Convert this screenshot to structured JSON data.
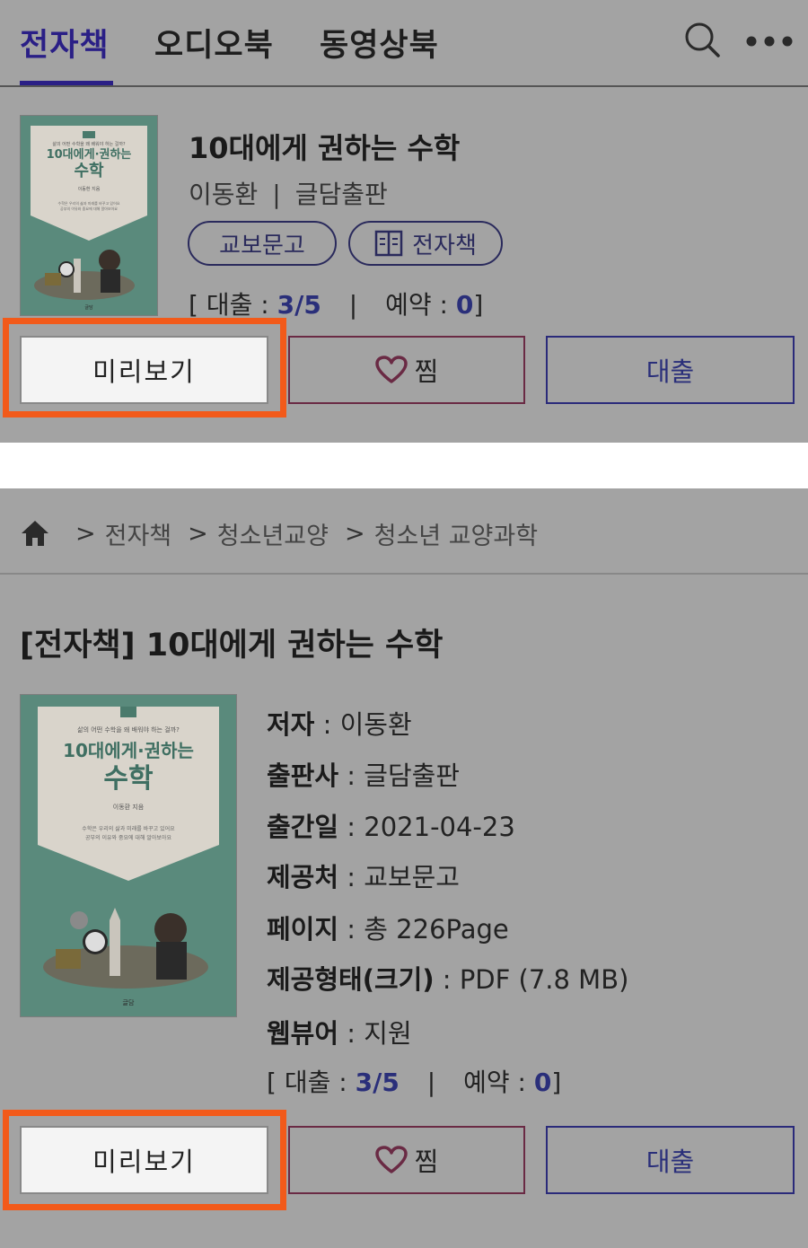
{
  "nav": {
    "tabs": [
      "전자책",
      "오디오북",
      "동영상북"
    ],
    "active_tab": "전자책",
    "accent_color": "#2a1f86"
  },
  "book": {
    "title": "10대에게 권하는 수학",
    "author": "이동환",
    "publisher": "글담출판",
    "author_publisher_sep": "|",
    "provider_pill": "교보문고",
    "format_pill": "전자책"
  },
  "loan_status": {
    "open_bracket": "[",
    "loan_label": "대출 :",
    "loan_value": "3/5",
    "sep": "|",
    "reserve_label": "예약 :",
    "reserve_value": "0",
    "close_bracket": "]"
  },
  "buttons": {
    "preview": "미리보기",
    "favorite": "찜",
    "loan": "대출"
  },
  "highlight_color": "#f25a1a",
  "breadcrumb": {
    "sep": ">",
    "items": [
      "전자책",
      "청소년교양",
      "청소년 교양과학"
    ]
  },
  "detail": {
    "title": "[전자책] 10대에게 권하는 수학",
    "fields": [
      {
        "key": "저자",
        "sep": " : ",
        "value": "이동환"
      },
      {
        "key": "출판사",
        "sep": " : ",
        "value": "글담출판"
      },
      {
        "key": "출간일",
        "sep": " : ",
        "value": "2021-04-23"
      },
      {
        "key": "제공처",
        "sep": " : ",
        "value": "교보문고"
      },
      {
        "key": "페이지",
        "sep": " : ",
        "value": "총 226Page"
      },
      {
        "key": "제공형태(크기)",
        "sep": " : ",
        "value": "PDF (7.8 MB)"
      },
      {
        "key": "웹뷰어",
        "sep": " : ",
        "value": "지원"
      }
    ]
  },
  "cover": {
    "top_small_text": "삶의 어떤 수학을 왜 배워야 하는 걸까?",
    "title_line1": "10대에게·권하는",
    "title_line2": "수학",
    "author_small": "이동환 지음",
    "desc_line1": "수학은 우리의 삶과 미래를 바꾸고 있어요",
    "desc_line2": "공부의 이유와 중요에 대해 알아보아요",
    "publisher_logo": "글담"
  }
}
